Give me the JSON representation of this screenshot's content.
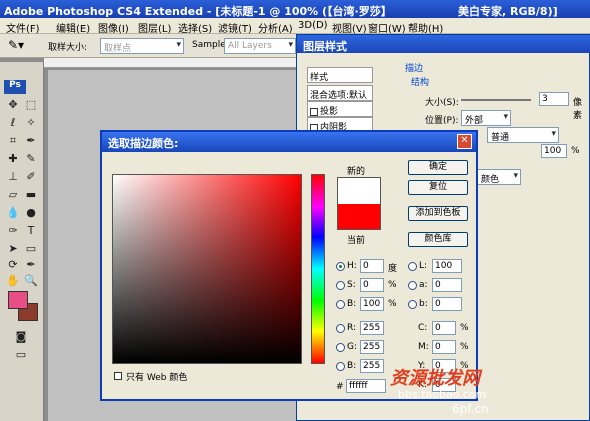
{
  "titlebar": {
    "title": "Adobe Photoshop CS4 Extended - [未标题-1 @ 100% (【台湾·罗莎】",
    "right": "美白专家, RGB/8)]"
  },
  "menu": [
    "文件(F)",
    "编辑(E)",
    "图像(I)",
    "图层(L)",
    "选择(S)",
    "滤镜(T)",
    "分析(A)",
    "3D(D)",
    "视图(V)",
    "窗口(W)",
    "帮助(H)"
  ],
  "options": {
    "sample_size_label": "取样大小:",
    "sample_size_value": "取样点",
    "sample_label": "Sample:",
    "sample_value": "All Layers"
  },
  "toolbox": {
    "logo": "Ps",
    "fg_color": "#e84f84",
    "bg_color": "#8b3a2c"
  },
  "layer_style": {
    "title": "图层样式",
    "left_items": [
      "样式",
      "混合选项:默认",
      "投影",
      "内阴影"
    ],
    "stroke_title": "描边",
    "structure_label": "结构",
    "size_label": "大小(S):",
    "size_value": "3",
    "size_unit": "像素",
    "position_label": "位置(P):",
    "position_value": "外部",
    "blend_value": "普通",
    "opacity_value": "100",
    "opacity_unit": "%",
    "fill_value": "颜色"
  },
  "color_picker": {
    "title": "选取描边颜色:",
    "new_label": "新的",
    "current_label": "当前",
    "new_color": "#ffffff",
    "current_color": "#ff0000",
    "buttons": {
      "ok": "确定",
      "reset": "复位",
      "add_swatch": "添加到色板",
      "library": "颜色库"
    },
    "hsb": {
      "h_label": "H:",
      "h": "0",
      "h_unit": "度",
      "s_label": "S:",
      "s": "0",
      "s_unit": "%",
      "b_label": "B:",
      "b": "100",
      "b_unit": "%"
    },
    "lab": {
      "l_label": "L:",
      "l": "100",
      "a_label": "a:",
      "a": "0",
      "b_label": "b:",
      "b": "0"
    },
    "rgb": {
      "r_label": "R:",
      "r": "255",
      "g_label": "G:",
      "g": "255",
      "b_label": "B:",
      "b": "255"
    },
    "cmyk": {
      "c_label": "C:",
      "c": "0",
      "m_label": "M:",
      "m": "0",
      "y_label": "Y:",
      "y": "0",
      "k_label": "K:",
      "k": "0",
      "unit": "%"
    },
    "hex_label": "#",
    "hex": "ffffff",
    "web_only": "只有 Web 颜色"
  },
  "watermark": {
    "line1": "资源批发网",
    "line2": "bbs.taobao.com",
    "line3": "6pf.cn"
  }
}
